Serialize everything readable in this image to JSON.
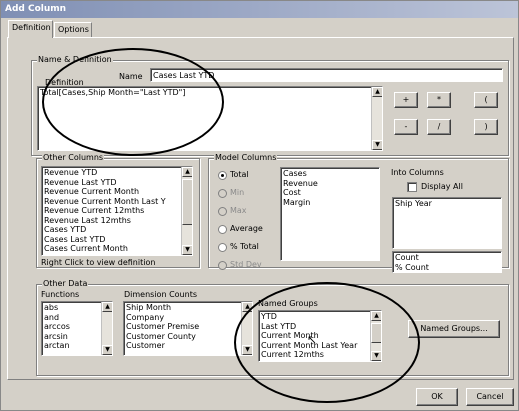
{
  "window": {
    "title": "Add Column"
  },
  "tabs": [
    {
      "label": "Definition"
    },
    {
      "label": "Options"
    }
  ],
  "name_definition": {
    "group_label": "Name & Definition",
    "definition_label": "Definition",
    "name_label": "Name",
    "name_value": "Cases Last YTD",
    "definition_value": "Total[Cases,Ship Month=\"Last YTD\"]"
  },
  "operators": [
    "+",
    "*",
    "(",
    "-",
    "/",
    ")"
  ],
  "other_columns": {
    "group_label": "Other Columns",
    "items": [
      "Revenue YTD",
      "Revenue Last YTD",
      "Revenue Current Month",
      "Revenue Current Month Last Y",
      "Revenue Current 12mths",
      "Revenue Last 12mths",
      "Cases YTD",
      "Cases Last YTD",
      "Cases Current Month"
    ],
    "hint": "Right Click to view definition"
  },
  "model_columns": {
    "group_label": "Model Columns",
    "radios": [
      {
        "label": "Total",
        "checked": true,
        "enabled": true
      },
      {
        "label": "Min",
        "checked": false,
        "enabled": false
      },
      {
        "label": "Max",
        "checked": false,
        "enabled": false
      },
      {
        "label": "Average",
        "checked": false,
        "enabled": true
      },
      {
        "label": "% Total",
        "checked": false,
        "enabled": true
      },
      {
        "label": "Std Dev",
        "checked": false,
        "enabled": false
      }
    ],
    "items": [
      "Cases",
      "Revenue",
      "Cost",
      "Margin"
    ]
  },
  "into_columns": {
    "label": "Into Columns",
    "display_all_label": "Display All",
    "items": [
      "Ship Year"
    ],
    "bottom_items": [
      "Count",
      "% Count"
    ]
  },
  "other_data": {
    "group_label": "Other Data",
    "functions_label": "Functions",
    "functions": [
      "abs",
      "and",
      "arccos",
      "arcsin",
      "arctan"
    ],
    "dimension_counts_label": "Dimension Counts",
    "dimension_counts": [
      "Ship Month",
      "Company",
      "Customer Premise",
      "Customer County",
      "Customer"
    ],
    "named_groups_label": "Named Groups",
    "named_groups": [
      "YTD",
      "Last YTD",
      "Current Month",
      "Current Month Last Year",
      "Current 12mths"
    ],
    "named_groups_button": "Named Groups..."
  },
  "footer": {
    "ok_label": "OK",
    "cancel_label": "Cancel"
  }
}
